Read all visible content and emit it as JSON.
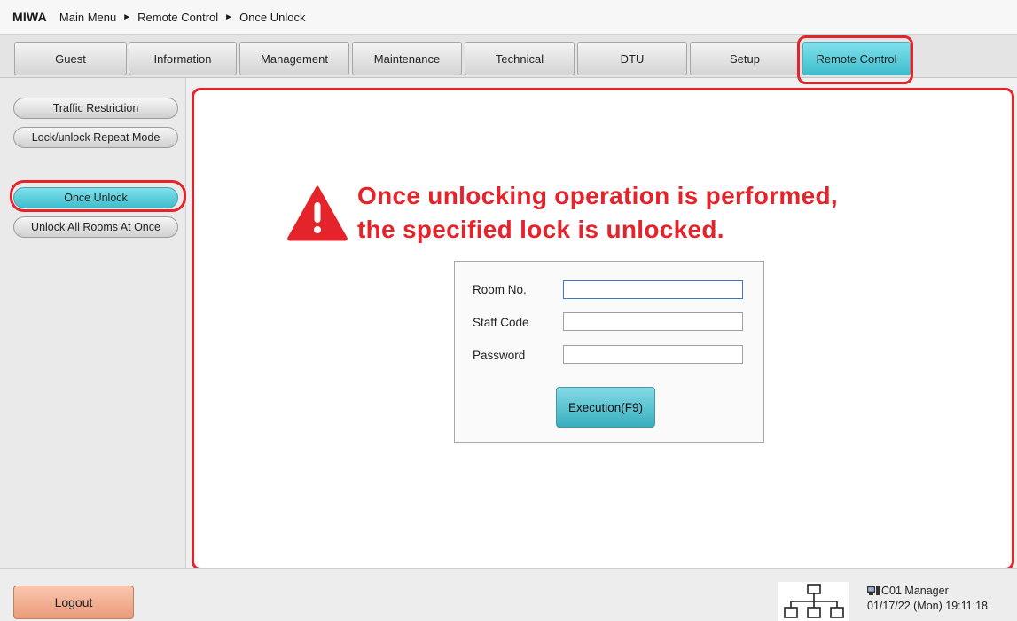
{
  "breadcrumb": {
    "brand": "MIWA",
    "items": [
      "Main Menu",
      "Remote Control",
      "Once Unlock"
    ],
    "separator": "►"
  },
  "tabs": [
    {
      "label": "Guest",
      "active": false
    },
    {
      "label": "Information",
      "active": false
    },
    {
      "label": "Management",
      "active": false
    },
    {
      "label": "Maintenance",
      "active": false
    },
    {
      "label": "Technical",
      "active": false
    },
    {
      "label": "DTU",
      "active": false
    },
    {
      "label": "Setup",
      "active": false
    },
    {
      "label": "Remote Control",
      "active": true
    }
  ],
  "sidebar": {
    "items": [
      {
        "label": "Traffic Restriction",
        "active": false
      },
      {
        "label": "Lock/unlock Repeat Mode",
        "active": false
      },
      {
        "label": "Once Unlock",
        "active": true
      },
      {
        "label": "Unlock All Rooms At Once",
        "active": false
      }
    ]
  },
  "warning": {
    "line1": "Once unlocking operation is performed,",
    "line2": "the specified lock is unlocked.",
    "icon": "warning-triangle-icon"
  },
  "form": {
    "room_label": "Room No.",
    "room_value": "",
    "staff_label": "Staff Code",
    "staff_value": "",
    "password_label": "Password",
    "password_value": "",
    "execute_label": "Execution(F9)"
  },
  "footer": {
    "logout_label": "Logout",
    "network_icon": "network-icon",
    "terminal": "C01 Manager",
    "datetime": "01/17/22 (Mon) 19:11:18"
  },
  "colors": {
    "highlight": "#e4232b",
    "active": "#3fbecd",
    "logout": "#ea9a78"
  }
}
